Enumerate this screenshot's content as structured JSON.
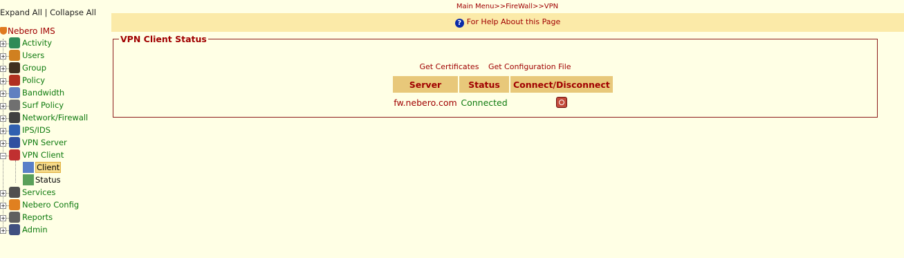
{
  "sidebar": {
    "expand_all": "Expand All",
    "separator": "|",
    "collapse_all": "Collapse All",
    "root": "Nebero IMS",
    "items": [
      {
        "label": "Activity",
        "icon": "activity-icon",
        "color": "#2e8b57"
      },
      {
        "label": "Users",
        "icon": "users-icon",
        "color": "#d08020"
      },
      {
        "label": "Group",
        "icon": "group-icon",
        "color": "#403020"
      },
      {
        "label": "Policy",
        "icon": "policy-icon",
        "color": "#b03020"
      },
      {
        "label": "Bandwidth",
        "icon": "bandwidth-icon",
        "color": "#6080c0"
      },
      {
        "label": "Surf Policy",
        "icon": "gear-icon",
        "color": "#707070"
      },
      {
        "label": "Network/Firewall",
        "icon": "network-icon",
        "color": "#404040"
      },
      {
        "label": "IPS/IDS",
        "icon": "globe-icon",
        "color": "#3060b0"
      },
      {
        "label": "VPN Server",
        "icon": "vpn-server-icon",
        "color": "#3050a0"
      },
      {
        "label": "VPN Client",
        "icon": "vpn-client-icon",
        "color": "#c03030"
      },
      {
        "label": "Services",
        "icon": "services-icon",
        "color": "#505050"
      },
      {
        "label": "Nebero Config",
        "icon": "shield-icon",
        "color": "#e08020"
      },
      {
        "label": "Reports",
        "icon": "reports-icon",
        "color": "#606060"
      },
      {
        "label": "Admin",
        "icon": "admin-icon",
        "color": "#405080"
      }
    ],
    "vpn_children": [
      {
        "label": "Client",
        "icon": "client-icon",
        "active": true
      },
      {
        "label": "Status",
        "icon": "status-icon",
        "active": false
      }
    ]
  },
  "breadcrumb": "Main Menu>>FireWall>>VPN",
  "help": {
    "icon": "?",
    "text": "For Help About this Page"
  },
  "panel": {
    "legend": "VPN Client Status",
    "get_certificates": "Get Certificates",
    "get_config": "Get Configuration File",
    "columns": [
      "Server",
      "Status",
      "Connect/Disconnect"
    ],
    "rows": [
      {
        "server": "fw.nebero.com",
        "status": "Connected",
        "action": "power-icon"
      }
    ]
  },
  "colors": {
    "background": "#ffffe5",
    "accent_red": "#a00000",
    "accent_green": "#0e7a0e",
    "header_fill": "#e8c87a",
    "help_bar": "#fbeaa8"
  }
}
